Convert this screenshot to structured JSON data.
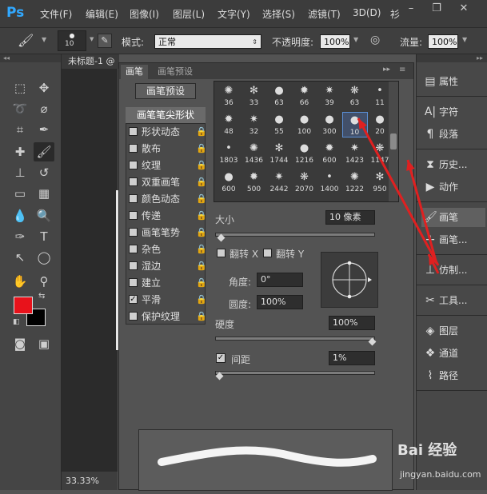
{
  "app": {
    "logo": "Ps"
  },
  "menu": [
    "文件(F)",
    "编辑(E)",
    "图像(I)",
    "图层(L)",
    "文字(Y)",
    "选择(S)",
    "滤镜(T)",
    "3D(D)",
    "衫"
  ],
  "window_controls": {
    "minimize": "–",
    "restore": "❐",
    "close": "✕"
  },
  "options_bar": {
    "brush_size": "10",
    "mode_label": "模式:",
    "mode_value": "正常",
    "opacity_label": "不透明度:",
    "opacity_value": "100%",
    "flow_label": "流量:",
    "flow_value": "100%"
  },
  "document": {
    "tab_title": "未标题-1 @",
    "zoom": "33.33%"
  },
  "brush_panel": {
    "tabs": [
      "画笔",
      "画笔预设"
    ],
    "presets_button": "画笔预设",
    "tip_shape_header": "画笔笔尖形状",
    "options": [
      {
        "label": "形状动态",
        "checked": false,
        "lock": true
      },
      {
        "label": "散布",
        "checked": false,
        "lock": true
      },
      {
        "label": "纹理",
        "checked": false,
        "lock": true
      },
      {
        "label": "双重画笔",
        "checked": false,
        "lock": true
      },
      {
        "label": "颜色动态",
        "checked": false,
        "lock": true
      },
      {
        "label": "传递",
        "checked": false,
        "lock": true
      },
      {
        "label": "画笔笔势",
        "checked": false,
        "lock": true
      },
      {
        "label": "杂色",
        "checked": false,
        "lock": true
      },
      {
        "label": "湿边",
        "checked": false,
        "lock": true
      },
      {
        "label": "建立",
        "checked": false,
        "lock": true
      },
      {
        "label": "平滑",
        "checked": true,
        "lock": true
      },
      {
        "label": "保护纹理",
        "checked": false,
        "lock": true
      }
    ],
    "tip_sizes": [
      [
        "36",
        "33",
        "63",
        "66",
        "39",
        "63",
        "11"
      ],
      [
        "48",
        "32",
        "55",
        "100",
        "300",
        "10",
        "20"
      ],
      [
        "1803",
        "1436",
        "1744",
        "1216",
        "600",
        "1423",
        "1147"
      ],
      [
        "600",
        "500",
        "2442",
        "2070",
        "1400",
        "1222",
        "950"
      ]
    ],
    "selected_tip": "10",
    "size_label": "大小",
    "size_value": "10 像素",
    "size_fraction": 0.02,
    "flip_x_label": "翻转 X",
    "flip_y_label": "翻转 Y",
    "angle_label": "角度:",
    "angle_value": "0°",
    "roundness_label": "圆度:",
    "roundness_value": "100%",
    "hardness_label": "硬度",
    "hardness_value": "100%",
    "hardness_fraction": 1.0,
    "spacing_label": "间距",
    "spacing_checked": true,
    "spacing_value": "1%",
    "spacing_fraction": 0.01
  },
  "right_panel": {
    "groups": [
      [
        {
          "icon": "properties-icon",
          "label": "属性"
        }
      ],
      [
        {
          "icon": "character-icon",
          "label": "字符"
        },
        {
          "icon": "paragraph-icon",
          "label": "段落"
        }
      ],
      [
        {
          "icon": "history-icon",
          "label": "历史..."
        },
        {
          "icon": "actions-icon",
          "label": "动作"
        }
      ],
      [
        {
          "icon": "brush-icon",
          "label": "画笔"
        },
        {
          "icon": "brush-presets-icon",
          "label": "画笔..."
        }
      ],
      [
        {
          "icon": "clone-source-icon",
          "label": "仿制..."
        }
      ],
      [
        {
          "icon": "tools-icon",
          "label": "工具..."
        }
      ],
      [
        {
          "icon": "layers-icon",
          "label": "图层"
        },
        {
          "icon": "channels-icon",
          "label": "通道"
        },
        {
          "icon": "paths-icon",
          "label": "路径"
        }
      ]
    ]
  },
  "colors": {
    "foreground": "#e8121b",
    "background": "#000000",
    "annotation_arrow": "#e02020"
  },
  "watermark": {
    "brand": "Bai 经验",
    "url": "jingyan.baidu.com"
  }
}
